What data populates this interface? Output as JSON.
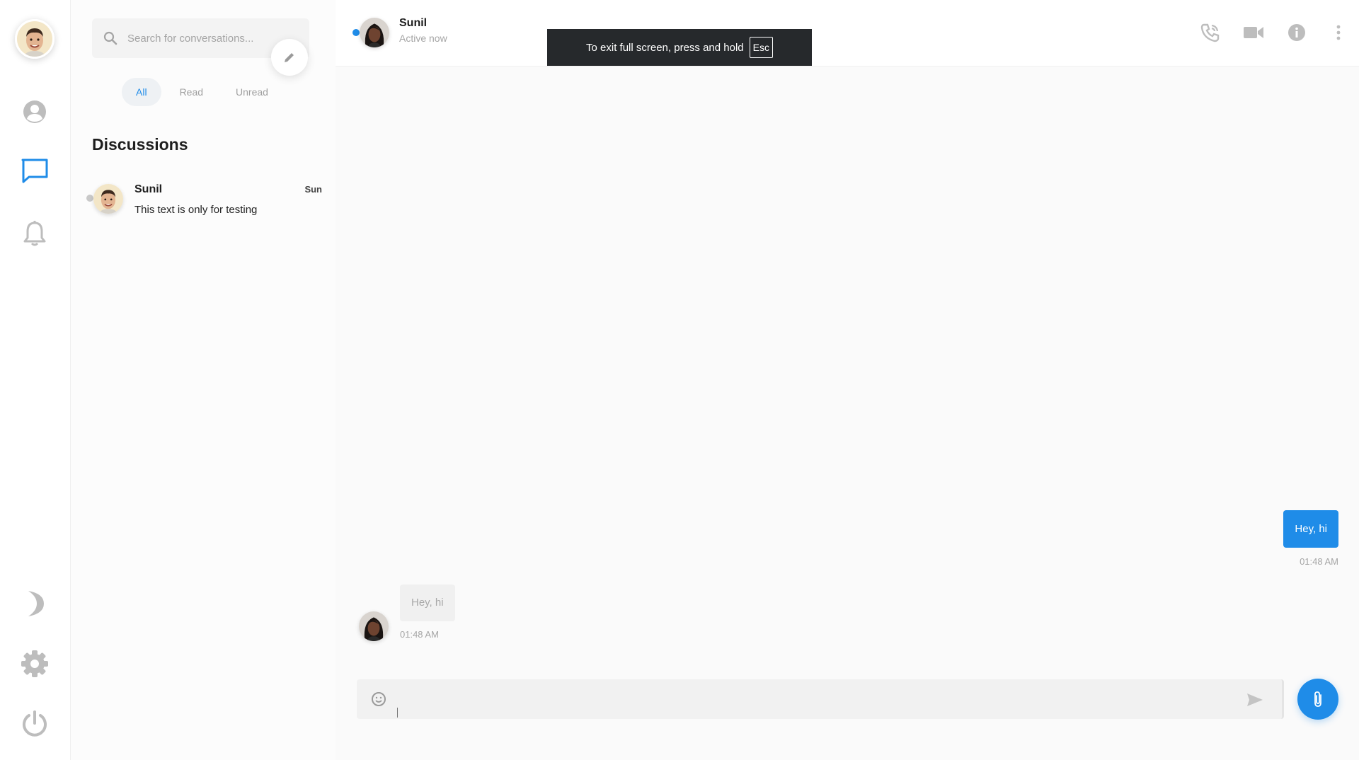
{
  "colors": {
    "accent": "#1f8ce8",
    "rail_icon": "#bdbdbd",
    "muted_text": "#a5a5a5"
  },
  "rail": {
    "items": [
      {
        "icon": "user-circle-icon",
        "active": false
      },
      {
        "icon": "chat-bubble-icon",
        "active": true
      },
      {
        "icon": "bell-icon",
        "active": false
      },
      {
        "icon": "moon-icon",
        "active": false
      },
      {
        "icon": "gear-icon",
        "active": false
      },
      {
        "icon": "power-icon",
        "active": false
      }
    ]
  },
  "search": {
    "placeholder": "Search for conversations..."
  },
  "filters": [
    {
      "label": "All",
      "active": true
    },
    {
      "label": "Read",
      "active": false
    },
    {
      "label": "Unread",
      "active": false
    }
  ],
  "list_heading": "Discussions",
  "conversations": [
    {
      "name": "Sunil",
      "time": "Sun",
      "preview": "This text is only for testing"
    }
  ],
  "chat": {
    "contact_name": "Sunil",
    "contact_status": "Active now",
    "header_actions": [
      "phone-icon",
      "video-camera-icon",
      "info-icon",
      "more-vertical-icon"
    ],
    "messages": [
      {
        "direction": "outgoing",
        "text": "Hey, hi",
        "time": "01:48 AM"
      },
      {
        "direction": "incoming",
        "text": "Hey, hi",
        "time": "01:48 AM"
      }
    ],
    "composer": {
      "value": "",
      "placeholder": ""
    }
  },
  "fullscreen_toast": {
    "text": "To exit full screen, press and hold",
    "key": "Esc"
  }
}
